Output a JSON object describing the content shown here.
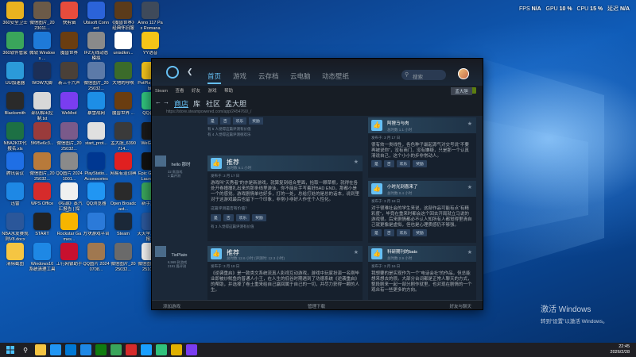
{
  "overlay": {
    "fps_label": "FPS",
    "fps_value": "N/A",
    "gpu_label": "GPU",
    "gpu_value": "10 %",
    "cpu_label": "CPU",
    "cpu_value": "15 %",
    "latency_label": "延迟",
    "latency_value": "N/A"
  },
  "desktop_icons": [
    {
      "label": "360安全卫士",
      "icon": "shield-icon",
      "color": "#e9b21f"
    },
    {
      "label": "微信图片_2023011...",
      "icon": "image-icon",
      "color": "#6b5a48"
    },
    {
      "label": "快剪辑",
      "icon": "scissors-icon",
      "color": "#e74c3c"
    },
    {
      "label": "Ubisoft Connect",
      "icon": "ubisoft-icon",
      "color": "#2b63d9"
    },
    {
      "label": "《魔兽世界》经典怀旧服",
      "icon": "wow-icon",
      "color": "#5b3b1a"
    },
    {
      "label": "Anno 117 Pax Romana",
      "icon": "anno-icon",
      "color": "#3f4a5a"
    },
    {
      "label": "360软件管家",
      "icon": "grid-icon",
      "color": "#3aa55b"
    },
    {
      "label": "微软 Windows ...",
      "icon": "windows-icon",
      "color": "#1e7ad8"
    },
    {
      "label": "魔兽世界",
      "icon": "wow-icon",
      "color": "#6a3d10"
    },
    {
      "label": "IFZ无线动态模拟",
      "icon": "image-icon",
      "color": "#8a8a8a"
    },
    {
      "label": "unisdkm...",
      "icon": "file-icon",
      "color": "#ffffff"
    },
    {
      "label": "YY语音",
      "icon": "yy-icon",
      "color": "#f5c518"
    },
    {
      "label": "UU加速器",
      "icon": "uu-icon",
      "color": "#2b9ad9"
    },
    {
      "label": "WOW大脚",
      "icon": "bigfoot-icon",
      "color": "#1c2f57"
    },
    {
      "label": "新三十六声",
      "icon": "game-icon",
      "color": "#4a4038"
    },
    {
      "label": "微信图片_2025032...",
      "icon": "image-icon",
      "color": "#5c7aa8"
    },
    {
      "label": "大地的呼唤",
      "icon": "wow-icon",
      "color": "#3b6b2a"
    },
    {
      "label": "PotPlayer 64 bit",
      "icon": "play-icon",
      "color": "#f2c21b"
    },
    {
      "label": "Blacksmith",
      "icon": "game-icon",
      "color": "#2a2a2a"
    },
    {
      "label": "部队解出控制.txt",
      "icon": "file-icon",
      "color": "#d8d8d8"
    },
    {
      "label": "WeMod",
      "icon": "wemod-icon",
      "color": "#7a3df0"
    },
    {
      "label": "暴雪战网",
      "icon": "battlenet-icon",
      "color": "#1d8ee6"
    },
    {
      "label": "魔兽世界 ...",
      "icon": "wow-icon",
      "color": "#6a3d10"
    },
    {
      "label": "QQ音乐",
      "icon": "music-icon",
      "color": "#31c27c"
    },
    {
      "label": "NBA2K世代 报名.xls",
      "icon": "excel-icon",
      "color": "#1d7044"
    },
    {
      "label": "5f6f5e6c3...",
      "icon": "image-icon",
      "color": "#9a3b3b"
    },
    {
      "label": "微信图片_2025032...",
      "icon": "image-icon",
      "color": "#7a5a8a"
    },
    {
      "label": "start_prot...",
      "icon": "file-icon",
      "color": "#e0e0e0"
    },
    {
      "label": "孟大胆_6390714...",
      "icon": "image-icon",
      "color": "#3a3a3a"
    },
    {
      "label": "WeGame",
      "icon": "wegame-icon",
      "color": "#1a1a1a"
    },
    {
      "label": "腾讯会议",
      "icon": "meeting-icon",
      "color": "#1f6fe5"
    },
    {
      "label": "微信图片_2025032...",
      "icon": "image-icon",
      "color": "#b87a3a"
    },
    {
      "label": "QQ图片 20241001...",
      "icon": "image-icon",
      "color": "#8a8a8a"
    },
    {
      "label": "PlayStatio... Accessories",
      "icon": "playstation-icon",
      "color": "#003791"
    },
    {
      "label": "网易有道词典",
      "icon": "dict-icon",
      "color": "#e02020"
    },
    {
      "label": "Epic Games Launcher",
      "icon": "epic-icon",
      "color": "#111111"
    },
    {
      "label": "迅雷",
      "icon": "thunder-icon",
      "color": "#1e88e5"
    },
    {
      "label": "WPS Office",
      "icon": "wps-icon",
      "color": "#d62b2b"
    },
    {
      "label": "《鸣潮》蒸汽汇报告 | 探索...",
      "icon": "file-icon",
      "color": "#f0f0f0"
    },
    {
      "label": "QQ浏览器",
      "icon": "browser-icon",
      "color": "#2196f3"
    },
    {
      "label": "Open Broadcast...",
      "icon": "obs-icon",
      "color": "#2a2a2a"
    },
    {
      "label": "新手盒子",
      "icon": "box-icon",
      "color": "#3aa55b"
    },
    {
      "label": "NBA水友赛规则V8.docx",
      "icon": "word-icon",
      "color": "#2b579a"
    },
    {
      "label": "START",
      "icon": "start-app-icon",
      "color": "#222222"
    },
    {
      "label": "Rockstar Games...",
      "icon": "rockstar-icon",
      "color": "#f7b500"
    },
    {
      "label": "方块游戏平台",
      "icon": "cube-icon",
      "color": "#2b7ad9"
    },
    {
      "label": "Steam",
      "icon": "steam-icon",
      "color": "#1b2838"
    },
    {
      "label": "天天学习赛事报名",
      "icon": "file-icon",
      "color": "#2b579a"
    },
    {
      "label": "清除截图",
      "icon": "folder-icon",
      "color": "#f5c542"
    },
    {
      "label": "Windows10 系统清理工具",
      "icon": "windows-icon",
      "color": "#1e88e5"
    },
    {
      "label": "工行网银助手",
      "icon": "bank-icon",
      "color": "#c8102e"
    },
    {
      "label": "QQ图片 20240708...",
      "icon": "image-icon",
      "color": "#a07850"
    },
    {
      "label": "微信图片_2025032...",
      "icon": "image-icon",
      "color": "#6a6a6a"
    },
    {
      "label": "微信图片_2025109...",
      "icon": "image-icon",
      "color": "#f0f0f0"
    }
  ],
  "steam": {
    "nav": {
      "home": "首页",
      "games": "游戏",
      "cloud": "云存档",
      "cloud_phone": "云电脑",
      "wallpaper": "动态壁纸"
    },
    "search_placeholder": "搜索",
    "menu": [
      "Steam",
      "查看",
      "好友",
      "游戏",
      "帮助"
    ],
    "user_btn": "孟大胆",
    "nav2": {
      "store": "商店",
      "library": "库",
      "community": "社区",
      "user": "孟大胆"
    },
    "url": "https://store.steampowered.com/app/2454760/_/",
    "top_reviews": [
      {
        "hint": "有 11 人觉得这篇评测有价值",
        "hint2": "有 4 人觉得这篇评测很欢乐"
      },
      {
        "hint": "有 5 人觉得这篇评测有价值",
        "hint2": "有 4 人觉得这篇评测很欢乐"
      }
    ],
    "vote": {
      "yes": "是",
      "no": "否",
      "funny": "欢乐",
      "award": "奖励"
    },
    "review1": {
      "user": "hello 那时",
      "games": "32 款游戏",
      "reviews": "1 篇评测",
      "label": "推荐",
      "hours": "总时数 5.1 小时",
      "posted": "发布于: 3 月 17 日",
      "body": "游戏叫“天秀者”的亦是新游戏，就算复刻组合里面，拾取一颗草根，就得在各处开卷撞撞扎出来的那条线里游泳，你不能反手写着好BAD END，那都小是一个的感觉。游戏剧情单也好多，打的一处，总给打处的是总的话本，说到里对于这游戏最后也留下一个印象，非常小非好人作任个人性化。",
      "question": "这篇评测是否有价值？",
      "foot": "有 3 人觉得这篇评测有价值"
    },
    "review2": {
      "user": "TioPlato",
      "games": "6,969 款游戏",
      "reviews": "2191 篇评测",
      "label": "推荐",
      "hours": "总时数 12.6 小时 (评测时: 12.3 小时)",
      "posted": "发布于: 3 月 18 日",
      "body": "《逆袭重启》是一款类文系统流真人影视互动游戏，游戏中玩家扮演一名刚毕业即被炒鱿鱼的普通人小王，在人生的低谷时期遇到了功德系统《逆袭重启》的帮助，并选择了卷土重来给自己赢回属于自己的一切，并尽力获得一颗的人生。"
    },
    "right_reviews": [
      {
        "user": "阿狸马与肉",
        "hours": "总时数 1.1 小时",
        "posted": "发布于: 3 月 17 日",
        "body": "很有效一类线性，各色种子最起源气对交号说“不要再被说你”，没有商门，没有嫌疑，只是那一个认真清说自己，这个小小的步非常动人。"
      },
      {
        "user": "小时光到喜来了",
        "hours": "总时数 0.4 小时",
        "posted": "发布于: 3 月 18 日",
        "body": "对于很难社会的学生来说，这部作品可能有点“有精彩度”，毕竟在重来时都会这个回去开局就立马说的游戏很。后来剧情都必不认人知所有人都觉得里清自己就更像是虚拟，但也是心理质感仍不够强。"
      },
      {
        "user": "科研期刊的bats",
        "hours": "总时数 2.9 小时",
        "posted": "发布于: 3 月 16 日",
        "body": "我想要的是实现作为一个“电话会社”的作品，但总能想来想去的很。大部分台词都是正常人聊天的方式，整段剧来一起一部分剧作就里，也对现在剧情的一个观众有一些更多的方向。"
      }
    ],
    "status": {
      "add_game": "添加游戏",
      "manage_downloads": "管理下载",
      "friends_chat": "好友与聊天"
    }
  },
  "activate": {
    "title": "激活 Windows",
    "subtitle": "转到“设置”以激活 Windows。"
  },
  "taskbar": {
    "time": "22:45",
    "date": "2026/2/28"
  }
}
